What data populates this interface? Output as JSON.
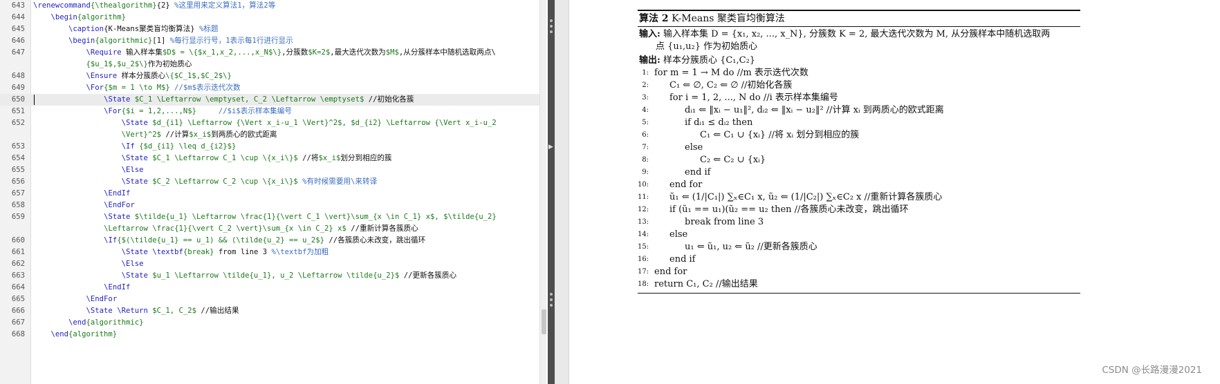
{
  "editor": {
    "current_line": "650",
    "lines": [
      {
        "num": "643",
        "segments": [
          {
            "c": "kw",
            "t": "\\renewcommand"
          },
          {
            "c": "arg",
            "t": "{\\thealgorithm}"
          },
          {
            "c": "cn",
            "t": "{2} "
          },
          {
            "c": "cmt",
            "t": "%这里用来定义算法1，算法2等"
          }
        ]
      },
      {
        "num": "644",
        "segments": [
          {
            "c": "cn",
            "t": "    "
          },
          {
            "c": "kw",
            "t": "\\begin"
          },
          {
            "c": "arg",
            "t": "{algorithm}"
          }
        ]
      },
      {
        "num": "645",
        "segments": [
          {
            "c": "cn",
            "t": "        "
          },
          {
            "c": "kw",
            "t": "\\caption"
          },
          {
            "c": "cn",
            "t": "{K-Means聚类盲均衡算法} "
          },
          {
            "c": "cmt",
            "t": "%标题"
          }
        ]
      },
      {
        "num": "646",
        "segments": [
          {
            "c": "cn",
            "t": "        "
          },
          {
            "c": "kw",
            "t": "\\begin"
          },
          {
            "c": "arg",
            "t": "{algorithmic}"
          },
          {
            "c": "cn",
            "t": "[1] "
          },
          {
            "c": "cmt",
            "t": "%每行显示行号，1表示每1行进行显示"
          }
        ]
      },
      {
        "num": "647",
        "segments": [
          {
            "c": "cn",
            "t": "            "
          },
          {
            "c": "kw",
            "t": "\\Require"
          },
          {
            "c": "cn",
            "t": " 输入样本集"
          },
          {
            "c": "math",
            "t": "$D$ = \\{$x_1,x_2,...,x_N$\\}"
          },
          {
            "c": "cn",
            "t": ",分簇数"
          },
          {
            "c": "math",
            "t": "$K=2$"
          },
          {
            "c": "cn",
            "t": ",最大迭代次数为"
          },
          {
            "c": "math",
            "t": "$M$"
          },
          {
            "c": "cn",
            "t": ",从分簇样本中随机选取两点\\"
          }
        ]
      },
      {
        "num": "",
        "segments": [
          {
            "c": "cn",
            "t": "            "
          },
          {
            "c": "math",
            "t": "{$u_1$,$u_2$\\}"
          },
          {
            "c": "cn",
            "t": "作为初始质心"
          }
        ]
      },
      {
        "num": "648",
        "segments": [
          {
            "c": "cn",
            "t": "            "
          },
          {
            "c": "kw",
            "t": "\\Ensure"
          },
          {
            "c": "cn",
            "t": " 样本分簇质心"
          },
          {
            "c": "math",
            "t": "\\{$C_1$,$C_2$\\}"
          }
        ]
      },
      {
        "num": "649",
        "segments": [
          {
            "c": "cn",
            "t": "            "
          },
          {
            "c": "kw",
            "t": "\\For"
          },
          {
            "c": "math",
            "t": "{$m = 1 \\to M$}"
          },
          {
            "c": "cn",
            "t": " "
          },
          {
            "c": "cmt",
            "t": "//$m$表示迭代次数"
          }
        ]
      },
      {
        "num": "650",
        "segments": [
          {
            "c": "cn",
            "t": "                "
          },
          {
            "c": "kw",
            "t": "\\State"
          },
          {
            "c": "math",
            "t": " $C_1 \\Leftarrow \\emptyset, C_2 \\Leftarrow \\emptyset$"
          },
          {
            "c": "cn",
            "t": " //初始化各簇"
          }
        ]
      },
      {
        "num": "651",
        "segments": [
          {
            "c": "cn",
            "t": "                "
          },
          {
            "c": "kw",
            "t": "\\For"
          },
          {
            "c": "math",
            "t": "{$i = 1,2,...,N$}"
          },
          {
            "c": "cn",
            "t": "     "
          },
          {
            "c": "cmt",
            "t": "//$i$表示样本集编号"
          }
        ]
      },
      {
        "num": "652",
        "segments": [
          {
            "c": "cn",
            "t": "                    "
          },
          {
            "c": "kw",
            "t": "\\State"
          },
          {
            "c": "math",
            "t": " $d_{i1} \\Leftarrow {\\Vert x_i-u_1 \\Vert}^2$, $d_{i2} \\Leftarrow {\\Vert x_i-u_2"
          }
        ]
      },
      {
        "num": "",
        "segments": [
          {
            "c": "cn",
            "t": "                    "
          },
          {
            "c": "math",
            "t": "\\Vert}^2$"
          },
          {
            "c": "cn",
            "t": " //计算"
          },
          {
            "c": "math",
            "t": "$x_i$"
          },
          {
            "c": "cn",
            "t": "到两质心的欧式距离"
          }
        ]
      },
      {
        "num": "653",
        "segments": [
          {
            "c": "cn",
            "t": "                    "
          },
          {
            "c": "kw",
            "t": "\\If"
          },
          {
            "c": "math",
            "t": " {$d_{i1} \\leq d_{i2}$}"
          }
        ]
      },
      {
        "num": "654",
        "segments": [
          {
            "c": "cn",
            "t": "                    "
          },
          {
            "c": "kw",
            "t": "\\State"
          },
          {
            "c": "math",
            "t": " $C_1 \\Leftarrow C_1 \\cup \\{x_i\\}$"
          },
          {
            "c": "cn",
            "t": " //将"
          },
          {
            "c": "math",
            "t": "$x_i$"
          },
          {
            "c": "cn",
            "t": "划分到相应的簇"
          }
        ]
      },
      {
        "num": "655",
        "segments": [
          {
            "c": "cn",
            "t": "                    "
          },
          {
            "c": "kw",
            "t": "\\Else"
          }
        ]
      },
      {
        "num": "656",
        "segments": [
          {
            "c": "cn",
            "t": "                    "
          },
          {
            "c": "kw",
            "t": "\\State"
          },
          {
            "c": "math",
            "t": " $C_2 \\Leftarrow C_2 \\cup \\{x_i\\}$"
          },
          {
            "c": "cn",
            "t": " "
          },
          {
            "c": "cmt",
            "t": "%有时候需要用\\来转译"
          }
        ]
      },
      {
        "num": "657",
        "segments": [
          {
            "c": "cn",
            "t": "                "
          },
          {
            "c": "kw",
            "t": "\\EndIf"
          }
        ]
      },
      {
        "num": "658",
        "segments": [
          {
            "c": "cn",
            "t": "                "
          },
          {
            "c": "kw",
            "t": "\\EndFor"
          }
        ]
      },
      {
        "num": "659",
        "segments": [
          {
            "c": "cn",
            "t": "                "
          },
          {
            "c": "kw",
            "t": "\\State"
          },
          {
            "c": "math",
            "t": " $\\tilde{u_1} \\Leftarrow \\frac{1}{\\vert C_1 \\vert}\\sum_{x \\in C_1} x$, $\\tilde{u_2}"
          }
        ]
      },
      {
        "num": "",
        "segments": [
          {
            "c": "cn",
            "t": "                "
          },
          {
            "c": "math",
            "t": "\\Leftarrow \\frac{1}{\\vert C_2 \\vert}\\sum_{x \\in C_2} x$"
          },
          {
            "c": "cn",
            "t": " //重新计算各簇质心"
          }
        ]
      },
      {
        "num": "660",
        "segments": [
          {
            "c": "cn",
            "t": "                "
          },
          {
            "c": "kw",
            "t": "\\If"
          },
          {
            "c": "math",
            "t": "{$(\\tilde{u_1} == u_1) && (\\tilde{u_2} == u_2$}"
          },
          {
            "c": "cn",
            "t": " //各簇质心未改变，跳出循环"
          }
        ]
      },
      {
        "num": "661",
        "segments": [
          {
            "c": "cn",
            "t": "                    "
          },
          {
            "c": "kw",
            "t": "\\State"
          },
          {
            "c": "cn",
            "t": " "
          },
          {
            "c": "kw",
            "t": "\\textbf"
          },
          {
            "c": "arg",
            "t": "{break}"
          },
          {
            "c": "cn",
            "t": " from line 3 "
          },
          {
            "c": "cmt",
            "t": "%\\textbf为加粗"
          }
        ]
      },
      {
        "num": "662",
        "segments": [
          {
            "c": "cn",
            "t": "                    "
          },
          {
            "c": "kw",
            "t": "\\Else"
          }
        ]
      },
      {
        "num": "663",
        "segments": [
          {
            "c": "cn",
            "t": "                    "
          },
          {
            "c": "kw",
            "t": "\\State"
          },
          {
            "c": "math",
            "t": " $u_1 \\Leftarrow \\tilde{u_1}, u_2 \\Leftarrow \\tilde{u_2}$"
          },
          {
            "c": "cn",
            "t": " //更新各簇质心"
          }
        ]
      },
      {
        "num": "664",
        "segments": [
          {
            "c": "cn",
            "t": "                "
          },
          {
            "c": "kw",
            "t": "\\EndIf"
          }
        ]
      },
      {
        "num": "665",
        "segments": [
          {
            "c": "cn",
            "t": "            "
          },
          {
            "c": "kw",
            "t": "\\EndFor"
          }
        ]
      },
      {
        "num": "666",
        "segments": [
          {
            "c": "cn",
            "t": "            "
          },
          {
            "c": "kw",
            "t": "\\State"
          },
          {
            "c": "cn",
            "t": " "
          },
          {
            "c": "kw",
            "t": "\\Return"
          },
          {
            "c": "math",
            "t": " $C_1, C_2$"
          },
          {
            "c": "cn",
            "t": " //输出结果"
          }
        ]
      },
      {
        "num": "667",
        "segments": [
          {
            "c": "cn",
            "t": "        "
          },
          {
            "c": "kw",
            "t": "\\end"
          },
          {
            "c": "arg",
            "t": "{algorithmic}"
          }
        ]
      },
      {
        "num": "668",
        "segments": [
          {
            "c": "cn",
            "t": "    "
          },
          {
            "c": "kw",
            "t": "\\end"
          },
          {
            "c": "arg",
            "t": "{algorithm}"
          }
        ]
      }
    ]
  },
  "preview": {
    "caption_label": "算法 2",
    "caption_title": "K-Means 聚类盲均衡算法",
    "input_label": "输入:",
    "input_text": "输入样本集 D = {x₁, x₂, ..., x_N}, 分簇数 K = 2, 最大迭代次数为 M, 从分簇样本中随机选取两",
    "input_text_cont": "点 {u₁,u₂} 作为初始质心",
    "output_label": "输出:",
    "output_text": "样本分簇质心 {C₁,C₂}",
    "lines": [
      {
        "num": "1:",
        "indent": 0,
        "text": "for m = 1 → M do //m 表示迭代次数"
      },
      {
        "num": "2:",
        "indent": 1,
        "text": "C₁ ⇐ ∅, C₂ ⇐ ∅ //初始化各簇"
      },
      {
        "num": "3:",
        "indent": 1,
        "text": "for i = 1, 2, ..., N do //i 表示样本集编号"
      },
      {
        "num": "4:",
        "indent": 2,
        "text": "dᵢ₁ ⇐ ‖xᵢ − u₁‖², dᵢ₂ ⇐ ‖xᵢ − u₂‖² //计算 xᵢ 到两质心的欧式距离"
      },
      {
        "num": "5:",
        "indent": 2,
        "text": "if dᵢ₁ ≤ dᵢ₂ then"
      },
      {
        "num": "6:",
        "indent": 3,
        "text": "C₁ ⇐ C₁ ∪ {xᵢ} //将 xᵢ 划分到相应的簇"
      },
      {
        "num": "7:",
        "indent": 2,
        "text": "else"
      },
      {
        "num": "8:",
        "indent": 3,
        "text": "C₂ ⇐ C₂ ∪ {xᵢ}"
      },
      {
        "num": "9:",
        "indent": 2,
        "text": "end if"
      },
      {
        "num": "10:",
        "indent": 1,
        "text": "end for"
      },
      {
        "num": "11:",
        "indent": 1,
        "text": "ũ₁ ⇐ (1/|C₁|) ∑ₓ∈C₁ x, ũ₂ ⇐ (1/|C₂|) ∑ₓ∈C₂ x //重新计算各簇质心"
      },
      {
        "num": "12:",
        "indent": 1,
        "text": "if (ũ₁ == u₁)(ũ₂ == u₂ then //各簇质心未改变，跳出循环"
      },
      {
        "num": "13:",
        "indent": 2,
        "text": "break from line 3"
      },
      {
        "num": "14:",
        "indent": 1,
        "text": "else"
      },
      {
        "num": "15:",
        "indent": 2,
        "text": "u₁ ⇐ ũ₁, u₂ ⇐ ũ₂ //更新各簇质心"
      },
      {
        "num": "16:",
        "indent": 1,
        "text": "end if"
      },
      {
        "num": "17:",
        "indent": 0,
        "text": "end for"
      },
      {
        "num": "18:",
        "indent": 0,
        "text": "return C₁, C₂ //输出结果"
      }
    ]
  },
  "watermark": "CSDN @长路漫漫2021",
  "colors": {
    "keyword": "#1f1fbf",
    "argument": "#1b7a1b",
    "math": "#1b7a1b",
    "comment": "#3c6ebf",
    "splitter": "#4e4e4e"
  },
  "icons": [
    "splitter-grip-icon",
    "collapse-arrow-icon"
  ]
}
